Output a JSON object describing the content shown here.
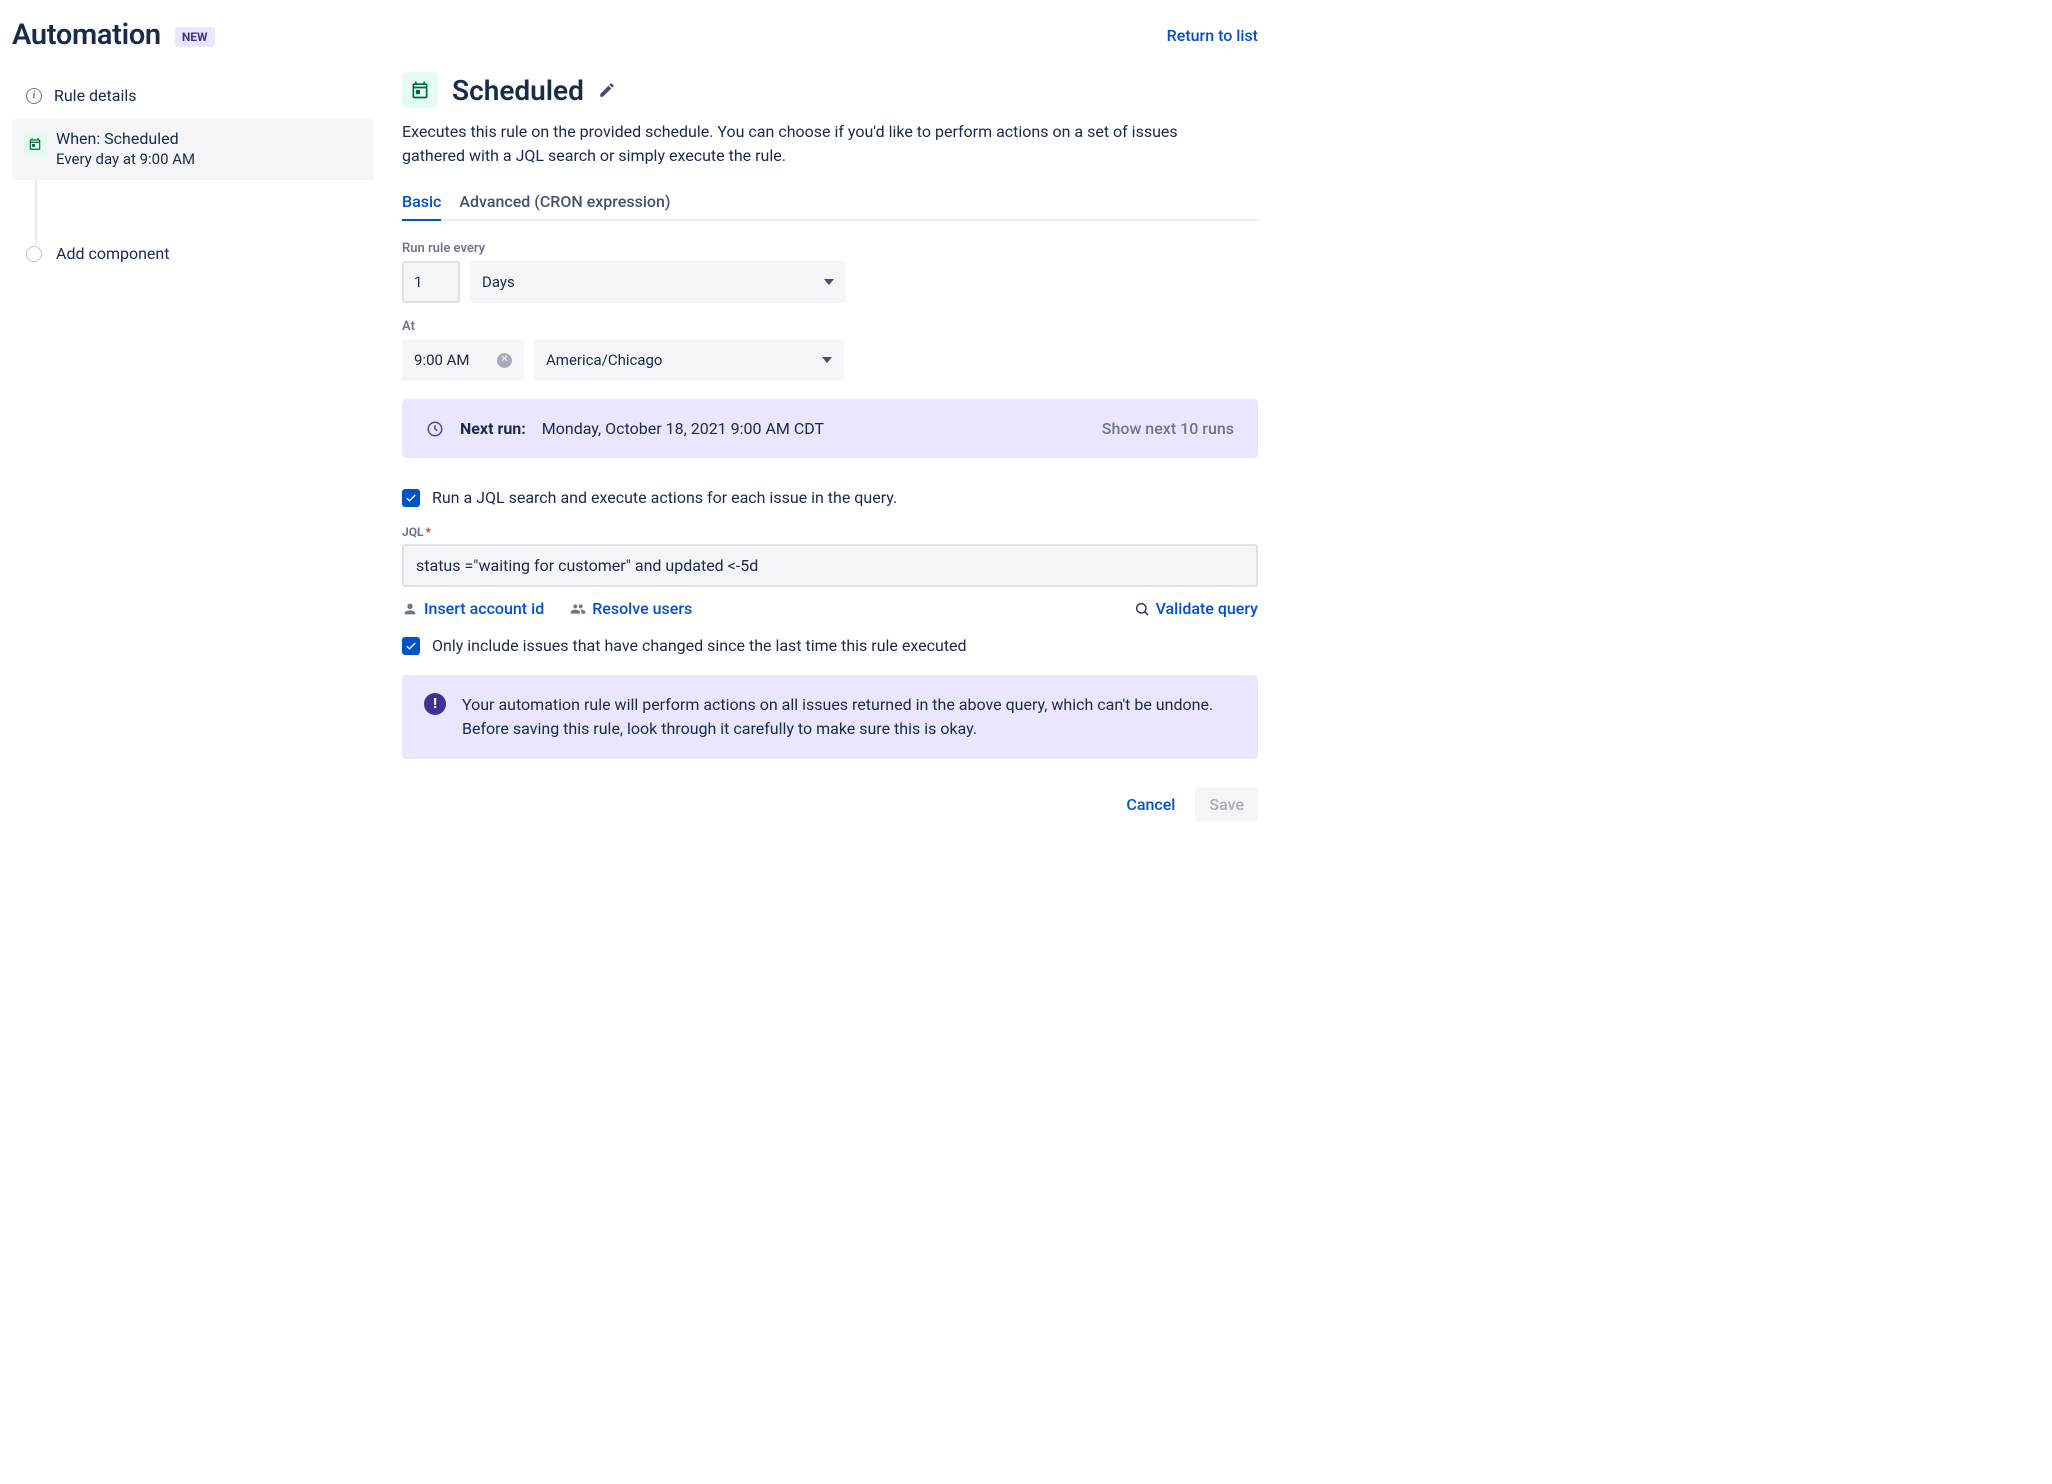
{
  "header": {
    "title": "Automation",
    "badge": "NEW",
    "return_link": "Return to list"
  },
  "sidebar": {
    "rule_details": "Rule details",
    "trigger": {
      "title": "When: Scheduled",
      "subtitle": "Every day at 9:00 AM"
    },
    "add_component": "Add component"
  },
  "main": {
    "title": "Scheduled",
    "description": "Executes this rule on the provided schedule. You can choose if you'd like to perform actions on a set of issues gathered with a JQL search or simply execute the rule.",
    "tabs": {
      "basic": "Basic",
      "advanced": "Advanced (CRON expression)"
    },
    "run_every": {
      "label": "Run rule every",
      "value": "1",
      "unit": "Days"
    },
    "at": {
      "label": "At",
      "time": "9:00 AM",
      "timezone": "America/Chicago"
    },
    "next_run": {
      "label": "Next run:",
      "value": "Monday, October 18, 2021 9:00 AM CDT",
      "show_next": "Show next 10 runs"
    },
    "jql_checkbox": "Run a JQL search and execute actions for each issue in the query.",
    "jql": {
      "label": "JQL",
      "value": "status =\"waiting for customer\" and updated <-5d"
    },
    "links": {
      "insert_account": "Insert account id",
      "resolve_users": "Resolve users",
      "validate_query": "Validate query"
    },
    "only_changed": "Only include issues that have changed since the last time this rule executed",
    "warning": "Your automation rule will perform actions on all issues returned in the above query, which can't be undone. Before saving this rule, look through it carefully to make sure this is okay.",
    "footer": {
      "cancel": "Cancel",
      "save": "Save"
    }
  }
}
